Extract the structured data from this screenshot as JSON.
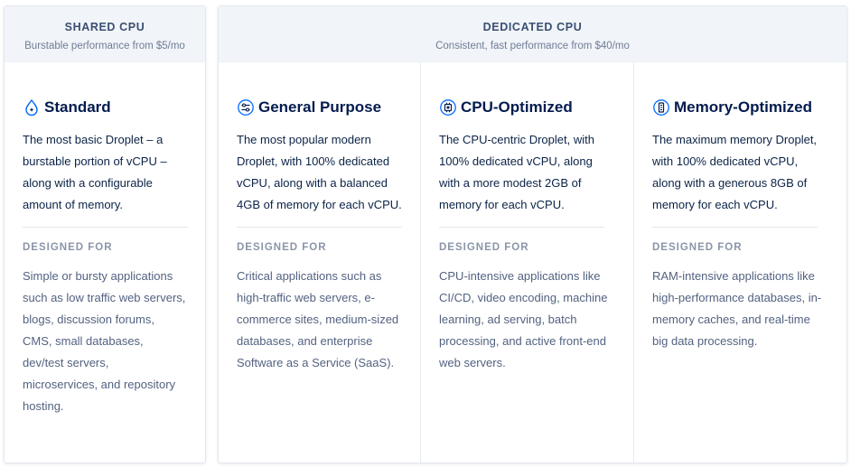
{
  "shared": {
    "title": "SHARED CPU",
    "subtitle": "Burstable performance from $5/mo",
    "plan": {
      "icon": "droplet-icon",
      "name": "Standard",
      "description": "The most basic Droplet – a burstable portion of vCPU – along with a configurable amount of memory.",
      "designed_for_label": "DESIGNED FOR",
      "designed_for": "Simple or bursty applications such as low traffic web servers, blogs, discussion forums, CMS, small databases, dev/test servers, microservices, and repository hosting."
    }
  },
  "dedicated": {
    "title": "DEDICATED CPU",
    "subtitle": "Consistent, fast performance from $40/mo",
    "plans": [
      {
        "icon": "sliders-icon",
        "name": "General Purpose",
        "description": "The most popular modern Droplet, with 100% dedicated vCPU, along with a balanced 4GB of memory for each vCPU.",
        "designed_for_label": "DESIGNED FOR",
        "designed_for": "Critical applications such as high-traffic web servers, e-commerce sites, medium-sized databases, and enterprise Software as a Service (SaaS)."
      },
      {
        "icon": "cpu-chip-icon",
        "name": "CPU-Optimized",
        "description": "The CPU-centric Droplet, with 100% dedicated vCPU, along with a more modest 2GB of memory for each vCPU.",
        "designed_for_label": "DESIGNED FOR",
        "designed_for": "CPU-intensive applications like CI/CD, video encoding, machine learning, ad serving, batch processing, and active front-end web servers."
      },
      {
        "icon": "memory-stick-icon",
        "name": "Memory-Optimized",
        "description": "The maximum memory Droplet, with 100% dedicated vCPU, along with a generous 8GB of memory for each vCPU.",
        "designed_for_label": "DESIGNED FOR",
        "designed_for": "RAM-intensive applications like high-performance databases, in-memory caches, and real-time big data processing."
      }
    ]
  },
  "colors": {
    "heading": "#031b4e",
    "accent": "#0069ff",
    "header_bg": "#f1f4f8",
    "muted": "#8b95a8"
  }
}
